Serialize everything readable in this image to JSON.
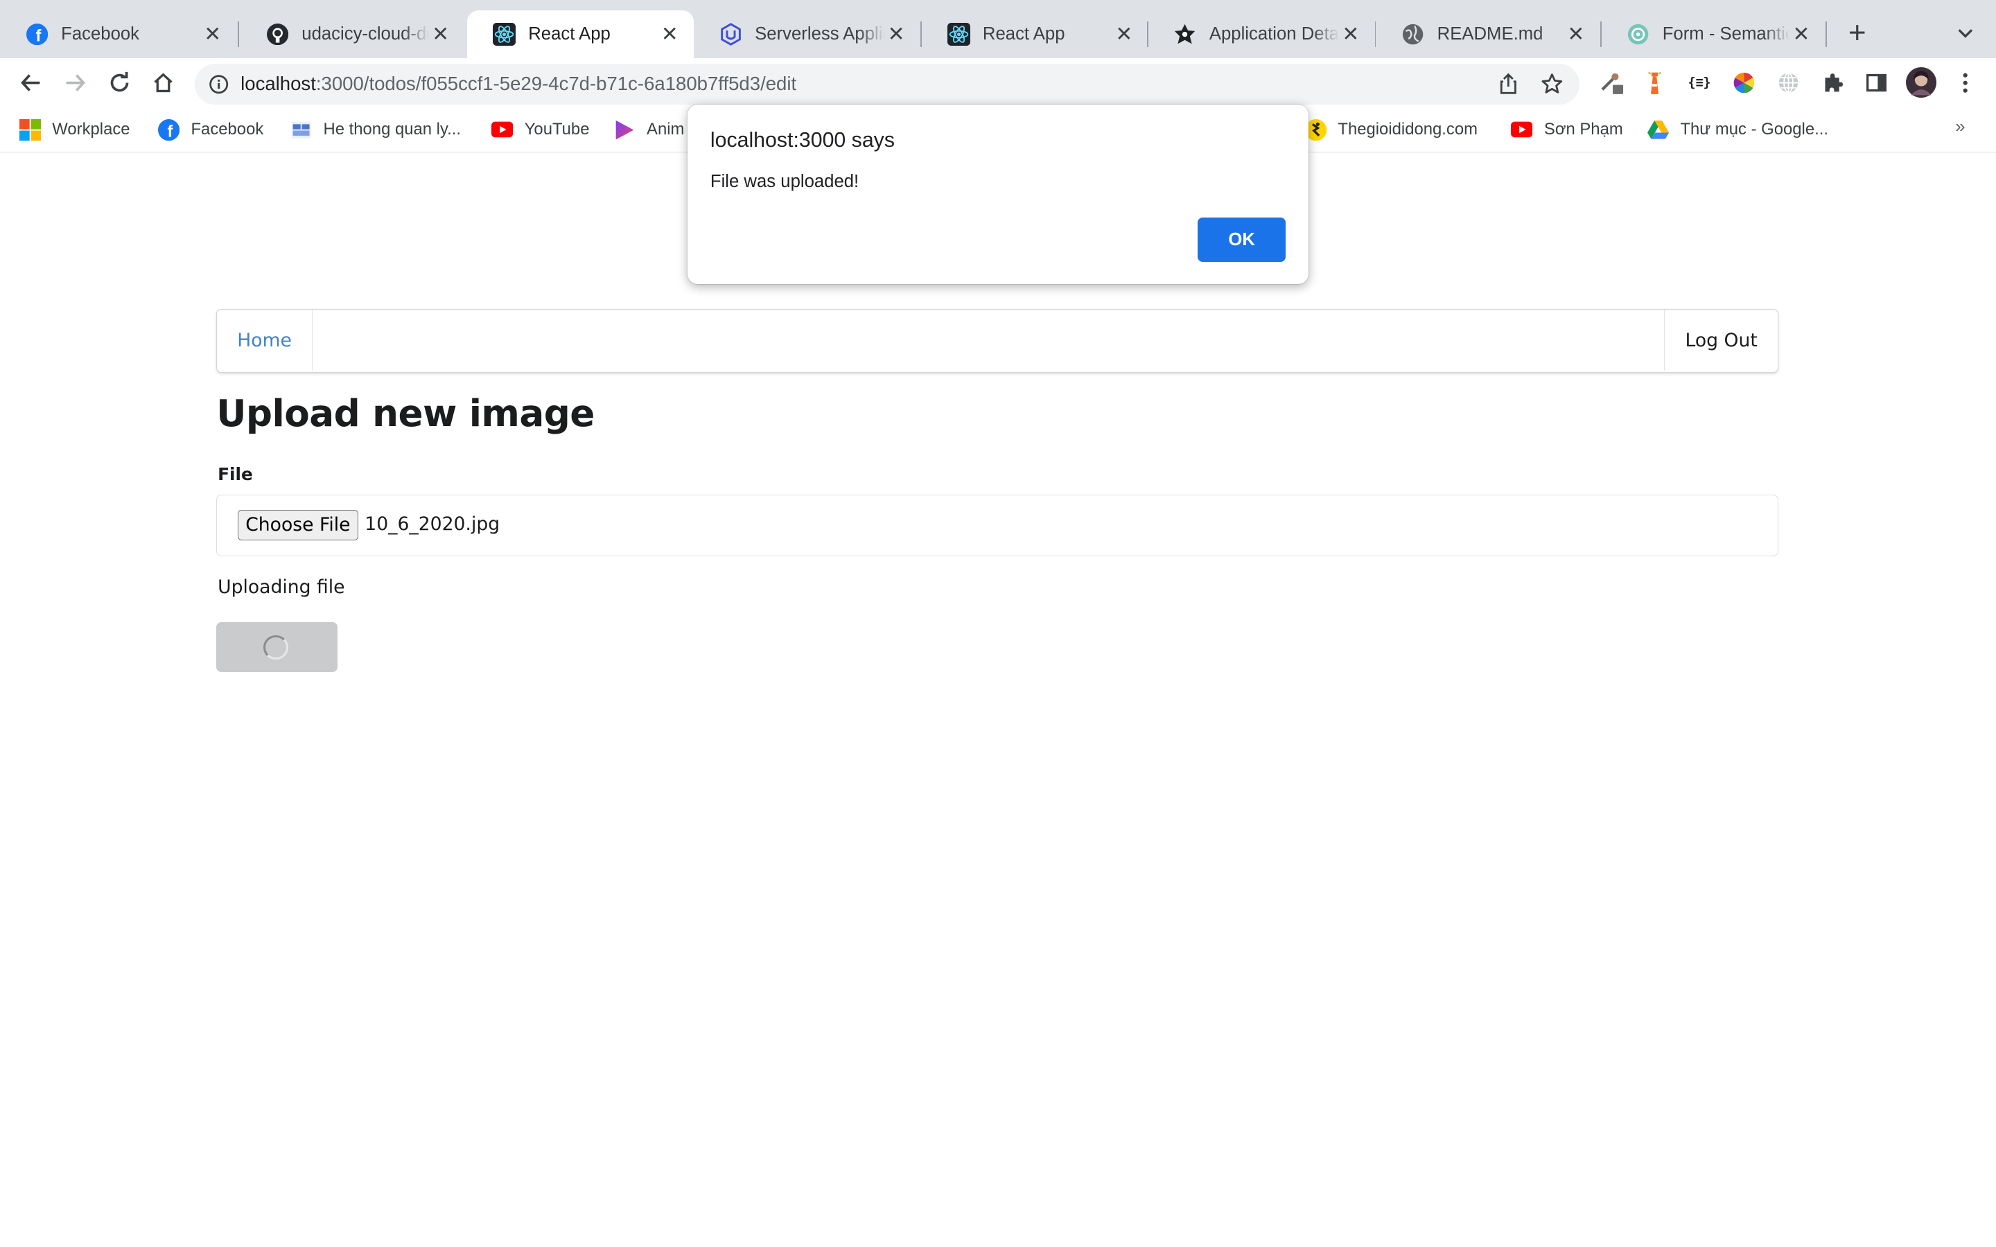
{
  "browser": {
    "tabs": [
      {
        "title": "Facebook",
        "icon": "facebook-icon"
      },
      {
        "title": "udacicy-cloud-de",
        "icon": "github-icon"
      },
      {
        "title": "React App",
        "icon": "react-icon",
        "active": true
      },
      {
        "title": "Serverless Applic",
        "icon": "udacity-icon"
      },
      {
        "title": "React App",
        "icon": "react-icon"
      },
      {
        "title": "Application Detai",
        "icon": "auth0-icon"
      },
      {
        "title": "README.md",
        "icon": "globe-icon"
      },
      {
        "title": "Form - Semantic",
        "icon": "chatgpt-icon"
      }
    ],
    "new_tab": "+",
    "address": {
      "host": "localhost",
      "path": ":3000/todos/f055ccf1-5e29-4c7d-b71c-6a180b7ff5d3/edit"
    },
    "bookmarks": [
      {
        "label": "Workplace",
        "icon": "workplace-icon"
      },
      {
        "label": "Facebook",
        "icon": "facebook-icon"
      },
      {
        "label": "He thong quan ly...",
        "icon": "uet-icon"
      },
      {
        "label": "YouTube",
        "icon": "youtube-icon"
      },
      {
        "label": "Anim",
        "icon": "play-icon"
      },
      {
        "label": "Thegioididong.com",
        "icon": "tgdd-icon"
      },
      {
        "label": "Sơn Phạm",
        "icon": "youtube-icon"
      },
      {
        "label": "Thư mục - Google...",
        "icon": "google-drive-icon"
      }
    ],
    "bookmarks_overflow": "»"
  },
  "page": {
    "menu": {
      "home": "Home",
      "logout": "Log Out"
    },
    "heading": "Upload new image",
    "file_label": "File",
    "choose_file": "Choose File",
    "file_name": "10_6_2020.jpg",
    "status": "Uploading file"
  },
  "dialog": {
    "title": "localhost:3000 says",
    "message": "File was uploaded!",
    "ok": "OK"
  },
  "colors": {
    "link": "#4183c4",
    "dialog_button": "#1a73e8",
    "loading_button": "#cacbcd"
  }
}
